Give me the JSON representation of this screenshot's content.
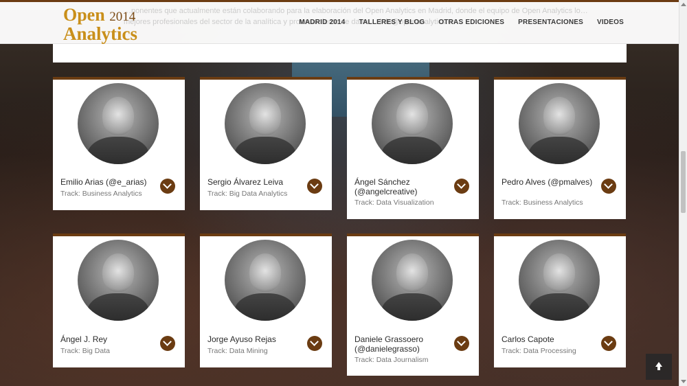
{
  "header": {
    "logo_line1": "Open",
    "logo_year": "2014",
    "logo_line2": "Analytics",
    "background_text": "…ponentes que actualmente están colaborando para la elaboración del Open Analytics en Madrid, donde el equipo de Open Analytics lo… mejores profesionales del sector de la analítica y procesamiento de datos… info@openanalytics.es",
    "nav": [
      {
        "label": "MADRID 2014"
      },
      {
        "label": "TALLERES Y BLOG"
      },
      {
        "label": "OTRAS EDICIONES"
      },
      {
        "label": "PRESENTACIONES"
      },
      {
        "label": "VIDEOS"
      }
    ]
  },
  "speakers": [
    {
      "name": "Emilio Arias (@e_arias)",
      "track": "Track: Business Analytics"
    },
    {
      "name": "Sergio Álvarez Leiva",
      "track": "Track: Big Data Analytics"
    },
    {
      "name": "Ángel Sánchez (@angelcreative)",
      "track": "Track: Data Visualization"
    },
    {
      "name": "Pedro Alves (@pmalves)",
      "track": "Track: Business Analytics"
    },
    {
      "name": "Ángel J. Rey",
      "track": "Track: Big Data"
    },
    {
      "name": "Jorge Ayuso Rejas",
      "track": "Track: Data Mining"
    },
    {
      "name": "Daniele Grassoero (@danielegrasso)",
      "track": "Track: Data Journalism"
    },
    {
      "name": "Carlos Capote",
      "track": "Track: Data Processing"
    }
  ],
  "colors": {
    "accent_brown": "#6b3c12",
    "logo_gold": "#c98f1a"
  },
  "icons": {
    "expand": "chevron-down-icon",
    "back_to_top": "arrow-up-icon"
  }
}
